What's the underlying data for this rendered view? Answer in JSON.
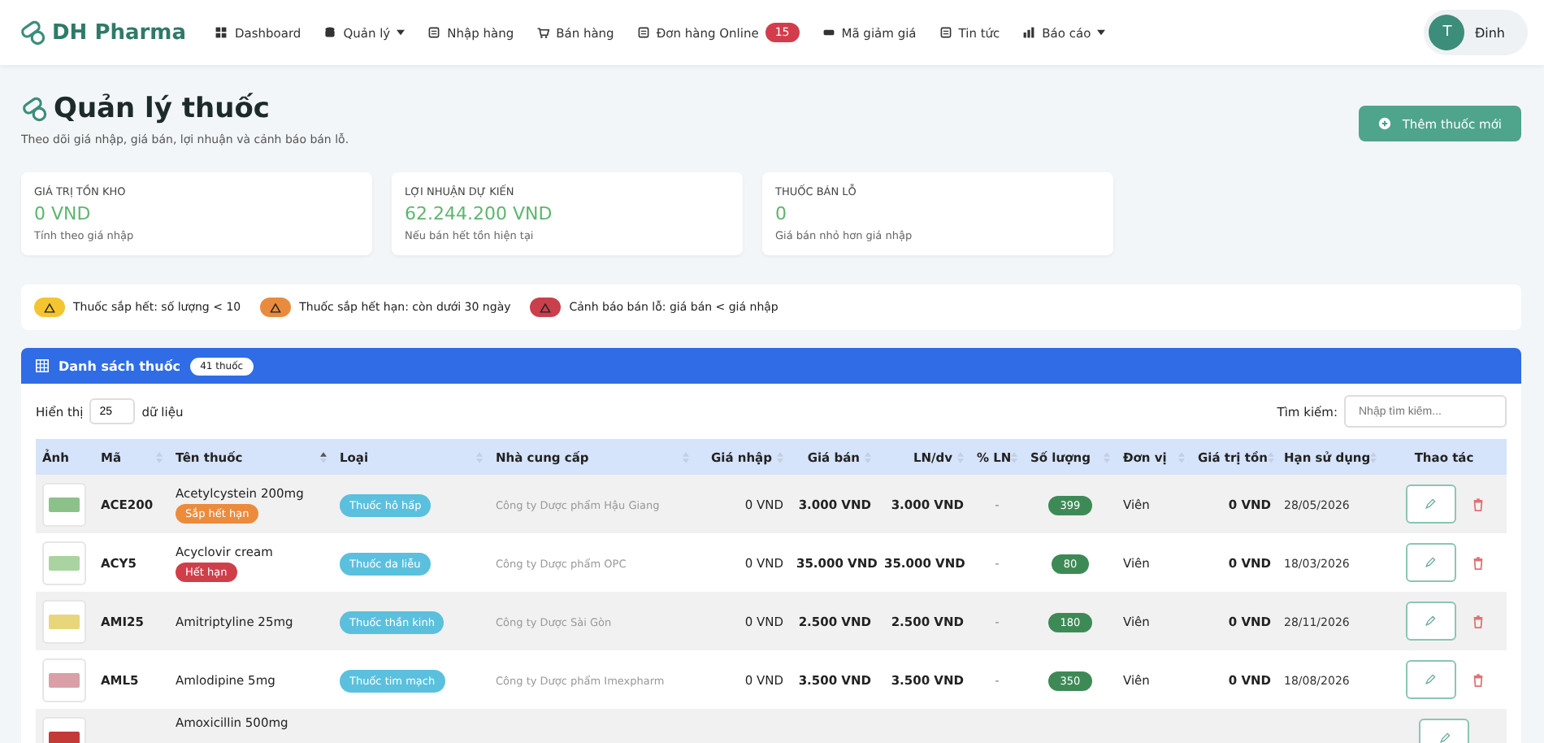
{
  "brand": "DH Pharma",
  "nav": [
    {
      "label": "Dashboard",
      "dropdown": false
    },
    {
      "label": "Quản lý",
      "dropdown": true
    },
    {
      "label": "Nhập hàng",
      "dropdown": false
    },
    {
      "label": "Bán hàng",
      "dropdown": false
    },
    {
      "label": "Đơn hàng Online",
      "dropdown": false,
      "badge": "15"
    },
    {
      "label": "Mã giảm giá",
      "dropdown": false
    },
    {
      "label": "Tin tức",
      "dropdown": false
    },
    {
      "label": "Báo cáo",
      "dropdown": true
    }
  ],
  "user": {
    "initial": "T",
    "name": "Đinh"
  },
  "page": {
    "title": "Quản lý thuốc",
    "subtitle": "Theo dõi giá nhập, giá bán, lợi nhuận và cảnh báo bán lỗ.",
    "add_button": "Thêm thuốc mới"
  },
  "stats": [
    {
      "label": "GIÁ TRỊ TỒN KHO",
      "value": "0 VND",
      "note": "Tính theo giá nhập"
    },
    {
      "label": "LỢI NHUẬN DỰ KIẾN",
      "value": "62.244.200 VND",
      "note": "Nếu bán hết tồn hiện tại"
    },
    {
      "label": "THUỐC BÁN LỖ",
      "value": "0",
      "note": "Giá bán nhỏ hơn giá nhập"
    }
  ],
  "legend": [
    {
      "kind": "low",
      "text": "Thuốc sắp hết: số lượng < 10"
    },
    {
      "kind": "expiring",
      "text": "Thuốc sắp hết hạn: còn dưới 30 ngày"
    },
    {
      "kind": "loss",
      "text": "Cảnh báo bán lỗ: giá bán < giá nhập"
    }
  ],
  "table": {
    "title": "Danh sách thuốc",
    "count": "41 thuốc",
    "show_label": "Hiển thị",
    "page_size": "25",
    "show_suffix": "dữ liệu",
    "search_label": "Tìm kiếm:",
    "search_placeholder": "Nhập tìm kiếm...",
    "columns": [
      {
        "label": "Ảnh",
        "sortable": false,
        "sorted": false
      },
      {
        "label": "Mã",
        "sortable": true,
        "sorted": false
      },
      {
        "label": "Tên thuốc",
        "sortable": true,
        "sorted": true
      },
      {
        "label": "Loại",
        "sortable": true,
        "sorted": false
      },
      {
        "label": "Nhà cung cấp",
        "sortable": true,
        "sorted": false
      },
      {
        "label": "Giá nhập",
        "sortable": true,
        "sorted": false
      },
      {
        "label": "Giá bán",
        "sortable": true,
        "sorted": false
      },
      {
        "label": "LN/dv",
        "sortable": true,
        "sorted": false
      },
      {
        "label": "% LN",
        "sortable": true,
        "sorted": false
      },
      {
        "label": "Số lượng",
        "sortable": true,
        "sorted": false
      },
      {
        "label": "Đơn vị",
        "sortable": true,
        "sorted": false
      },
      {
        "label": "Giá trị tồn",
        "sortable": true,
        "sorted": false
      },
      {
        "label": "Hạn sử dụng",
        "sortable": true,
        "sorted": false
      },
      {
        "label": "Thao tác",
        "sortable": false,
        "sorted": false
      }
    ],
    "rows": [
      {
        "code": "ACE200",
        "name": "Acetylcystein 200mg",
        "status": {
          "kind": "expiring",
          "label": "Sắp hết hạn"
        },
        "category": "Thuốc hô hấp",
        "supplier": "Công ty Dược phẩm Hậu Giang",
        "cost": "0 VND",
        "price": "3.000 VND",
        "profit": "3.000 VND",
        "pct": "-",
        "qty": "399",
        "unit": "Viên",
        "stock_value": "0 VND",
        "expiry": "28/05/2026"
      },
      {
        "code": "ACY5",
        "name": "Acyclovir cream",
        "status": {
          "kind": "expired",
          "label": "Hết hạn"
        },
        "category": "Thuốc da liễu",
        "supplier": "Công ty Dược phẩm OPC",
        "cost": "0 VND",
        "price": "35.000 VND",
        "profit": "35.000 VND",
        "pct": "-",
        "qty": "80",
        "unit": "Viên",
        "stock_value": "0 VND",
        "expiry": "18/03/2026"
      },
      {
        "code": "AMI25",
        "name": "Amitriptyline 25mg",
        "category": "Thuốc thần kinh",
        "supplier": "Công ty Dược Sài Gòn",
        "cost": "0 VND",
        "price": "2.500 VND",
        "profit": "2.500 VND",
        "pct": "-",
        "qty": "180",
        "unit": "Viên",
        "stock_value": "0 VND",
        "expiry": "28/11/2026"
      },
      {
        "code": "AML5",
        "name": "Amlodipine 5mg",
        "category": "Thuốc tim mạch",
        "supplier": "Công ty Dược phẩm Imexpharm",
        "cost": "0 VND",
        "price": "3.500 VND",
        "profit": "3.500 VND",
        "pct": "-",
        "qty": "350",
        "unit": "Viên",
        "stock_value": "0 VND",
        "expiry": "18/08/2026"
      },
      {
        "name": "Amoxicillin 500mg"
      }
    ]
  }
}
